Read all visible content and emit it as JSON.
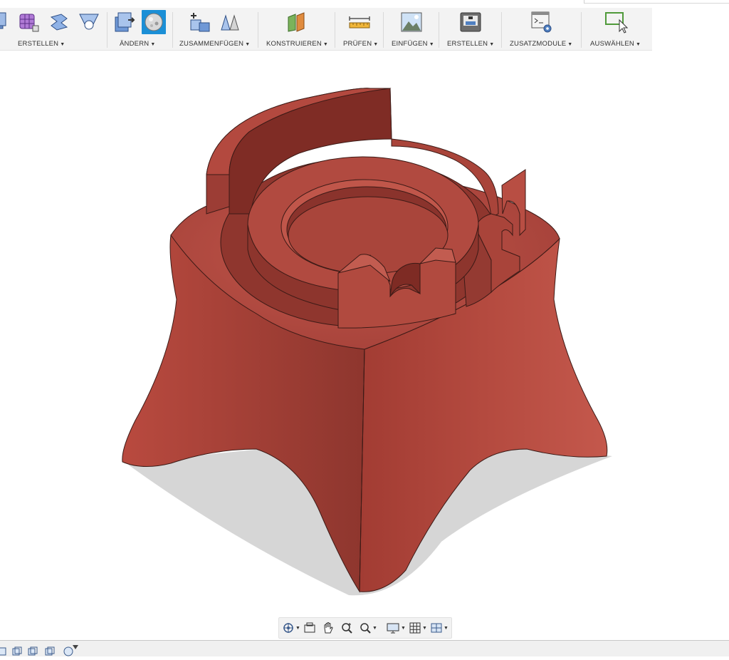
{
  "colors": {
    "model": "#b0443a",
    "model_dark": "#7f2c25",
    "model_light": "#c85a4e",
    "shadow": "#cfcfcf",
    "toolbar_bg": "#f3f3f3",
    "active_tool": "#1b8fd6"
  },
  "toolbar": {
    "groups": [
      {
        "id": "erstellen",
        "label": "ERSTELLEN",
        "icons": [
          "extrude-icon",
          "form-grid-icon",
          "revolve-icon",
          "sweep-icon"
        ]
      },
      {
        "id": "aendern",
        "label": "ÄNDERN",
        "icons": [
          "press-pull-icon",
          "appearance-icon"
        ],
        "active_icon": "appearance-icon"
      },
      {
        "id": "zusammenfuegen",
        "label": "ZUSAMMENFÜGEN",
        "icons": [
          "joint-icon",
          "as-built-joint-icon"
        ]
      },
      {
        "id": "konstruieren",
        "label": "KONSTRUIEREN",
        "icons": [
          "construct-plane-icon"
        ]
      },
      {
        "id": "pruefen",
        "label": "PRÜFEN",
        "icons": [
          "measure-icon"
        ]
      },
      {
        "id": "einfuegen",
        "label": "EINFÜGEN",
        "icons": [
          "insert-image-icon"
        ]
      },
      {
        "id": "erstellen2",
        "label": "ERSTELLEN",
        "icons": [
          "3d-print-icon"
        ]
      },
      {
        "id": "zusatzmodule",
        "label": "ZUSATZMODULE",
        "icons": [
          "scripts-addins-icon"
        ]
      },
      {
        "id": "auswaehlen",
        "label": "AUSWÄHLEN",
        "icons": [
          "select-window-icon"
        ]
      }
    ]
  },
  "viewport": {
    "model": "spool-holder-body"
  },
  "navbar": {
    "tools": [
      "orbit-icon",
      "look-at-icon",
      "pan-icon",
      "zoom-icon",
      "fit-icon",
      "display-settings-icon",
      "grid-settings-icon",
      "viewports-icon"
    ]
  },
  "statusbar": {
    "icons": [
      "timeline-start-icon",
      "timeline-back-icon",
      "timeline-play-icon",
      "timeline-forward-icon",
      "timeline-settings-icon"
    ]
  }
}
